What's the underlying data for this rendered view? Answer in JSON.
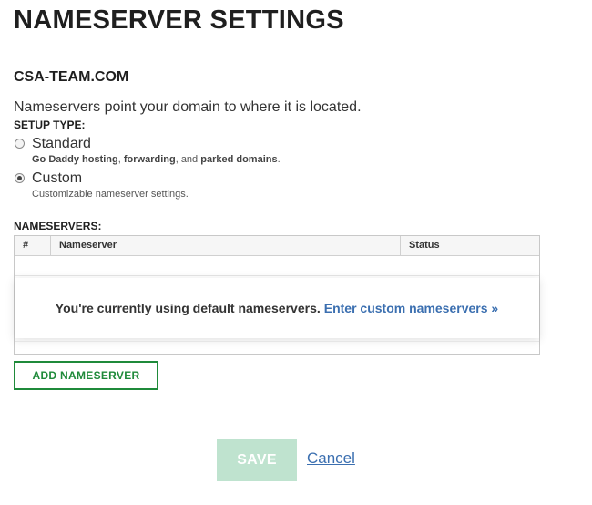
{
  "page": {
    "title": "NAMESERVER SETTINGS",
    "domain": "CSA-TEAM.COM",
    "intro": "Nameservers point your domain to where it is located."
  },
  "setup": {
    "label": "SETUP TYPE:",
    "selected": "Custom",
    "options": [
      {
        "label": "Standard",
        "desc_parts": [
          "Go Daddy hosting",
          ", ",
          "forwarding",
          ", and ",
          "parked domains",
          "."
        ]
      },
      {
        "label": "Custom",
        "desc": "Customizable nameserver settings."
      }
    ]
  },
  "nameservers": {
    "label": "NAMESERVERS:",
    "columns": [
      "#",
      "Nameserver",
      "Status"
    ],
    "rows": [],
    "notice_text": "You're currently using default nameservers.",
    "notice_link": "Enter custom nameservers »",
    "add_button": "ADD NAMESERVER"
  },
  "actions": {
    "save": "SAVE",
    "cancel": "Cancel"
  },
  "colors": {
    "accent_green": "#1f8a3a",
    "save_disabled_bg": "#bfe3cf",
    "link_blue": "#3b6fb0"
  }
}
